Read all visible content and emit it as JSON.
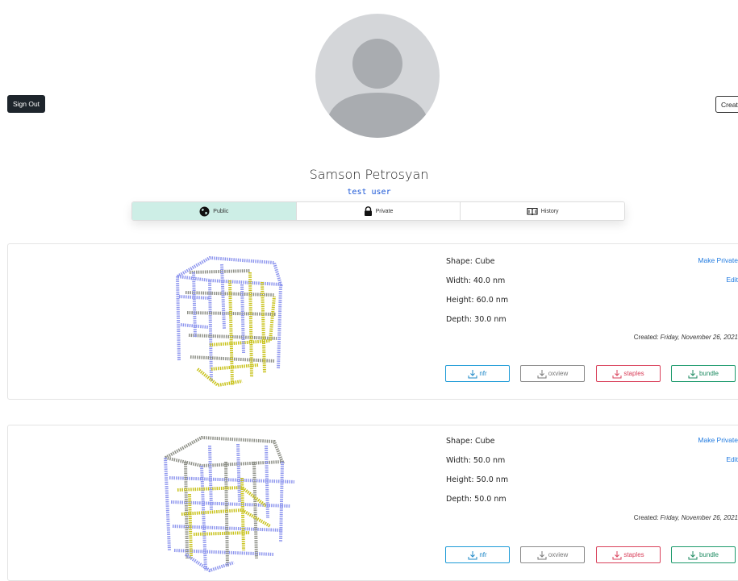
{
  "header": {
    "sign_out_label": "Sign Out",
    "create_label": "Creat"
  },
  "profile": {
    "name": "Samson Petrosyan",
    "subtitle": "test user"
  },
  "tabs": [
    {
      "label": "Public",
      "icon": "globe-icon",
      "active": true
    },
    {
      "label": "Private",
      "icon": "lock-icon",
      "active": false
    },
    {
      "label": "History",
      "icon": "book-icon",
      "active": false
    }
  ],
  "designs": [
    {
      "shape": "Shape: Cube",
      "width": "Width: 40.0 nm",
      "height": "Height: 60.0 nm",
      "depth": "Depth: 30.0 nm",
      "make_private": "Make Private",
      "edit": "Edit",
      "created_prefix": "Created: ",
      "created_date": "Friday, November 26, 2021",
      "downloads": {
        "nfr": "nfr",
        "oxview": "oxview",
        "staples": "staples",
        "bundle": "bundle"
      }
    },
    {
      "shape": "Shape: Cube",
      "width": "Width: 50.0 nm",
      "height": "Height: 50.0 nm",
      "depth": "Depth: 50.0 nm",
      "make_private": "Make Private",
      "edit": "Edit",
      "created_prefix": "Created: ",
      "created_date": "Friday, November 26, 2021",
      "downloads": {
        "nfr": "nfr",
        "oxview": "oxview",
        "staples": "staples",
        "bundle": "bundle"
      }
    }
  ],
  "colors": {
    "active_tab": "#cdeee6",
    "nfr": "#1e9bd7",
    "oxview": "#8a8a8a",
    "staples": "#d9415b",
    "bundle": "#1c9a6c",
    "helix_blue": "#8f97ee",
    "helix_yellow": "#c8c21a",
    "helix_gray": "#8d8f86"
  }
}
